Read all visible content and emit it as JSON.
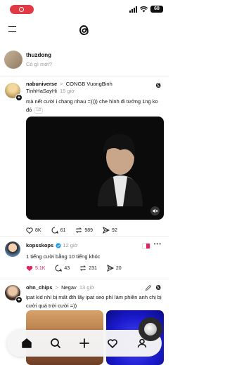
{
  "status_bar": {
    "battery": "68"
  },
  "composer": {
    "username": "thuzdong",
    "placeholder": "Có gì mới?"
  },
  "posts": [
    {
      "author": "nabuniverse",
      "separator": ">",
      "topic": "CONGB VuongBinh",
      "topic_cont": "TinhHaSayHi",
      "time": "15 giờ",
      "text": "mà nết cười i chang nhau =)))) che hình đi tưởng 1ng ko đó",
      "page": "1/2",
      "likes": "8K",
      "comments": "61",
      "reposts": "989",
      "shares": "92"
    },
    {
      "author": "kopsskops",
      "time": "12 giờ",
      "text": "1 tiếng cười bằng 10 tiếng khóc",
      "likes": "5.1K",
      "comments": "43",
      "reposts": "231",
      "shares": "20"
    },
    {
      "author": "ohn_chips",
      "separator": ">",
      "topic": "Negav",
      "time": "13 giờ",
      "text": "ipat kid nhí bị mất đth lấy ipat seo phì làm phiền anh chị bị cười quá trời cười =))"
    }
  ],
  "colors": {
    "liked": "#e0245e",
    "recording": "#e23a45",
    "verified": "#1d9bf0"
  },
  "icons": [
    "menu-icon",
    "threads-logo-icon",
    "heart-icon",
    "comment-icon",
    "repost-icon",
    "share-icon",
    "home-icon",
    "search-icon",
    "plus-icon",
    "activity-icon",
    "profile-icon"
  ]
}
